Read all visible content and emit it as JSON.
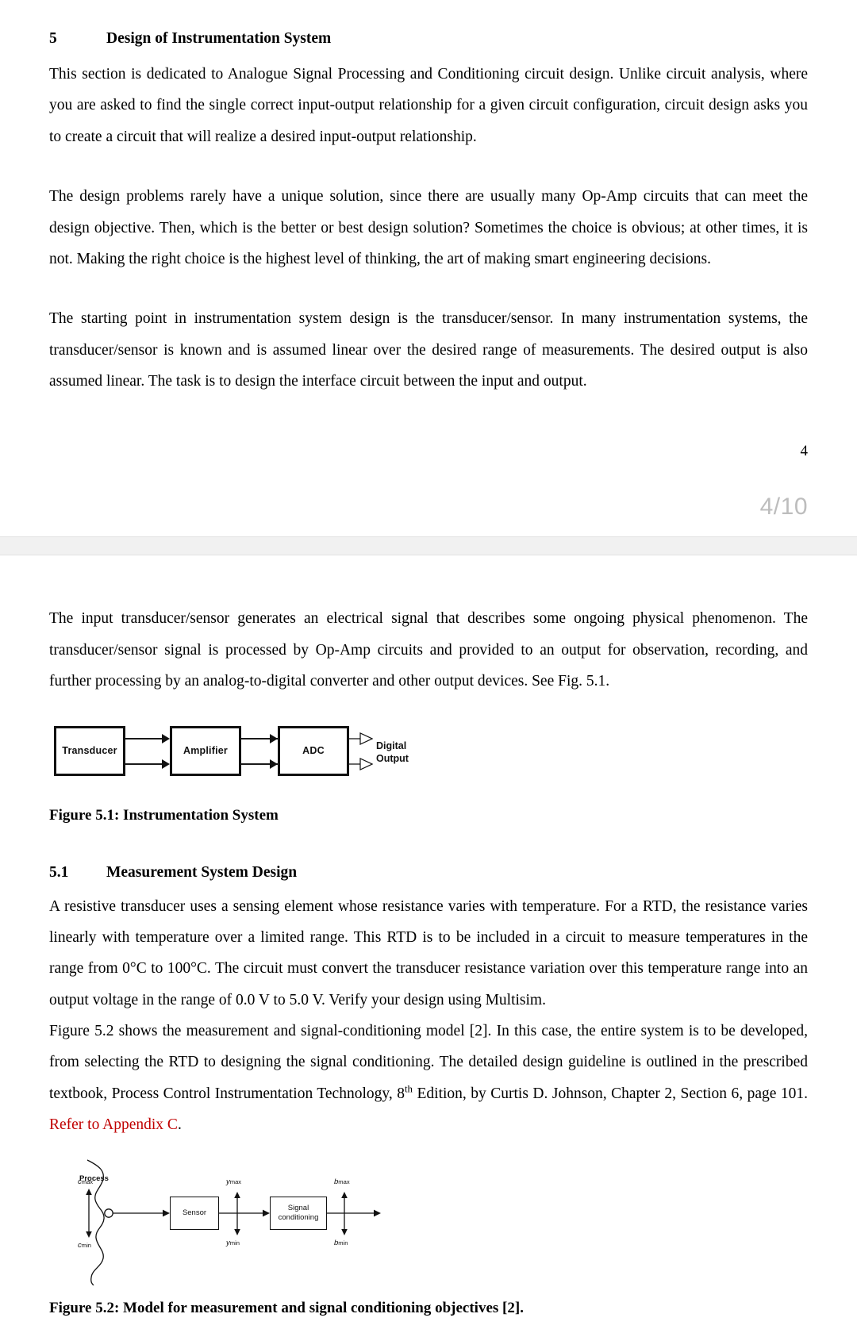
{
  "document": {
    "page_label": "4",
    "page_counter": "4/10"
  },
  "section5": {
    "number": "5",
    "title": "Design of Instrumentation System",
    "paragraphs": [
      "This section is dedicated to Analogue Signal Processing and Conditioning circuit design. Unlike circuit analysis, where you are asked to find the single correct input-output relationship for a given circuit configuration, circuit design asks you to create a circuit that will realize a desired input-output relationship.",
      "The design problems rarely have a unique solution, since there are usually many Op-Amp circuits that can meet the design objective. Then, which is the better or best design solution? Sometimes the choice is obvious; at other times, it is not. Making the right choice is the highest level of thinking, the art of making smart engineering decisions.",
      "The starting point in instrumentation system design is the transducer/sensor. In many instrumentation systems, the transducer/sensor is known and is assumed linear over the desired range of measurements. The desired output is also assumed linear. The task is to design the interface circuit between the input and output."
    ]
  },
  "page5": {
    "intro_paragraph": "The input transducer/sensor generates an electrical signal that describes some ongoing physical phenomenon. The transducer/sensor signal is processed by Op-Amp circuits and provided to an output for observation, recording, and further processing by an analog-to-digital converter and other output devices. See Fig. 5.1."
  },
  "figure51": {
    "caption": "Figure 5.1: Instrumentation System",
    "blocks": [
      {
        "label": "Transducer"
      },
      {
        "label": "Amplifier"
      },
      {
        "label": "ADC"
      }
    ],
    "output_label_line1": "Digital",
    "output_label_line2": "Output"
  },
  "section51": {
    "number": "5.1",
    "title": "Measurement System Design",
    "paragraph1": "A resistive transducer uses a sensing element whose resistance varies with temperature. For a RTD, the resistance varies linearly with temperature over a limited range. This RTD is to be included in a circuit to measure temperatures in the range from 0°C to 100°C. The circuit must convert the transducer resistance variation over this temperature range into an output voltage in the range of 0.0 V to 5.0 V.  Verify your design using Multisim.",
    "paragraph2_part1": "Figure 5.2 shows the measurement and signal-conditioning model [2]. In this case, the entire system is to be developed, from selecting the RTD to designing the signal conditioning. The detailed design guideline is outlined in the prescribed textbook, Process Control Instrumentation Technology, 8",
    "paragraph2_sup": "th",
    "paragraph2_part2": " Edition, by Curtis D. Johnson, Chapter 2, Section 6, page 101. ",
    "paragraph2_red": "Refer to Appendix C",
    "paragraph2_end": "."
  },
  "figure52": {
    "caption": "Figure 5.2: Model for measurement and signal conditioning objectives [2].",
    "process_label": "Process",
    "c_symbol": "c",
    "y_symbol": "y",
    "b_symbol": "b",
    "sub_max": "max",
    "sub_min": "min",
    "sensor_label": "Sensor",
    "conditioning_line1": "Signal",
    "conditioning_line2": "conditioning"
  },
  "colors": {
    "accent_red": "#c00000",
    "page_counter_gray": "#bdbdbd",
    "page_gap_gray": "#f1f1f1"
  }
}
